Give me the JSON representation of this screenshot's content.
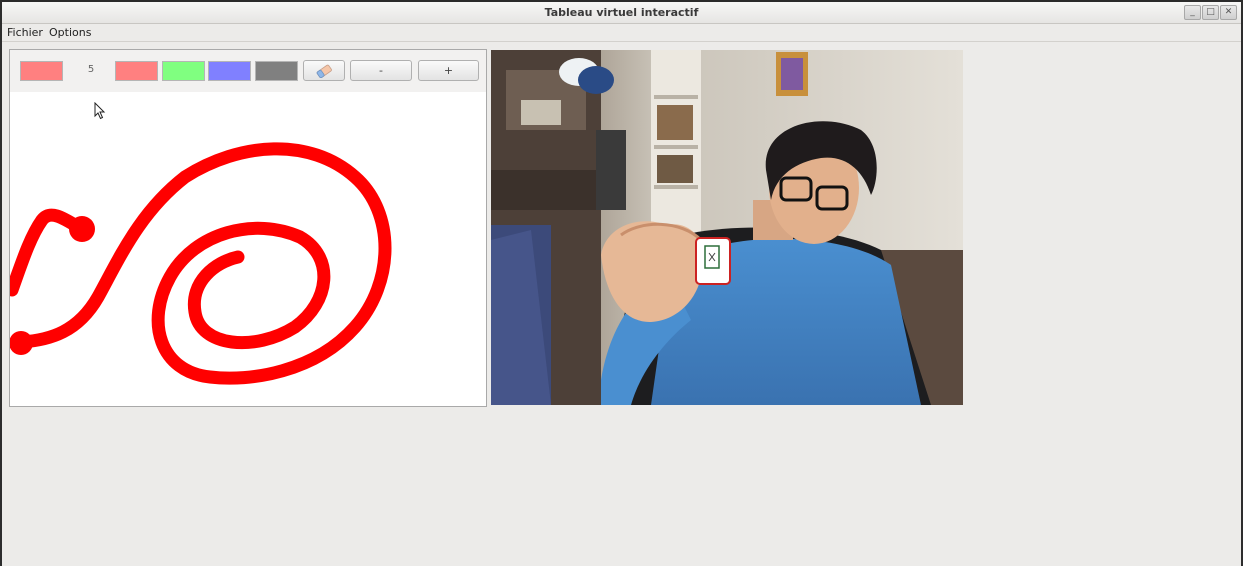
{
  "window": {
    "title": "Tableau virtuel interactif"
  },
  "window_controls": {
    "minimize": "_",
    "maximize": "□",
    "close": "✕"
  },
  "menu": {
    "file_label": "Fichier",
    "options_label": "Options"
  },
  "toolbar": {
    "current_color": "#ff8080",
    "brush_size": "5",
    "palette": [
      {
        "name": "red",
        "color": "#ff8080"
      },
      {
        "name": "green",
        "color": "#80ff80"
      },
      {
        "name": "blue",
        "color": "#8080ff"
      },
      {
        "name": "gray",
        "color": "#808080"
      }
    ],
    "eraser_icon": "eraser-icon",
    "decrease_label": "-",
    "increase_label": "+"
  },
  "drawing": {
    "stroke_color": "#ff0000"
  },
  "webcam": {
    "description_free": true
  }
}
